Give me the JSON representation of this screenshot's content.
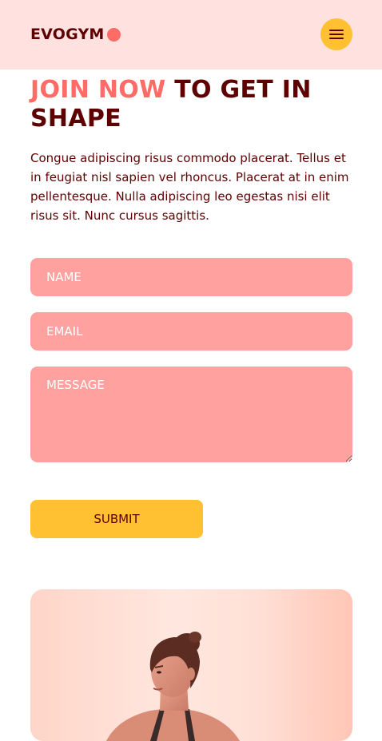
{
  "navbar": {
    "logo_text": "EVOGYM",
    "menu_icon": "hamburger-menu-icon",
    "brand_color": "#ff6b66",
    "menu_button_color": "#ffc132"
  },
  "heading": {
    "accent": "JOIN NOW",
    "rest": " TO GET IN SHAPE"
  },
  "intro": "Congue adipiscing risus commodo placerat. Tellus et in feugiat nisl sapien vel rhoncus. Placerat at in enim pellentesque. Nulla adipiscing leo egestas nisi elit risus sit. Nunc cursus sagittis.",
  "form": {
    "name_placeholder": "NAME",
    "email_placeholder": "EMAIL",
    "message_placeholder": "MESSAGE",
    "submit_label": "SUBMIT",
    "field_color": "#ffa29f"
  },
  "image": {
    "description_icon": "woman-photo"
  }
}
